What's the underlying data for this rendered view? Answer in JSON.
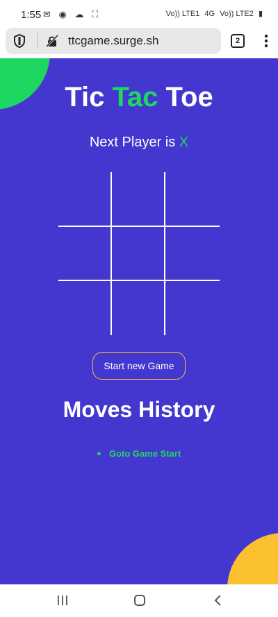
{
  "status_bar": {
    "time": "1:55",
    "left_icons": "✉ ◉ ☁ ⛶",
    "right_indicators": [
      "Vo)) LTE1",
      "4G",
      "Vo)) LTE2",
      "▮"
    ]
  },
  "browser": {
    "url": "ttcgame.surge.sh",
    "tab_count": "2",
    "menu_glyph": "⋮"
  },
  "game": {
    "title_part1": "Tic ",
    "title_part2": "Tac",
    "title_part3": " Toe",
    "next_player_label": "Next Player is ",
    "next_player_value": "X",
    "board": [
      "",
      "",
      "",
      "",
      "",
      "",
      "",
      "",
      ""
    ],
    "start_button_label": "Start new Game"
  },
  "history": {
    "title": "Moves History",
    "items": [
      "Goto Game Start"
    ]
  },
  "colors": {
    "background": "#4437cf",
    "accent_green": "#1ed760",
    "accent_yellow": "#fbc02d"
  }
}
